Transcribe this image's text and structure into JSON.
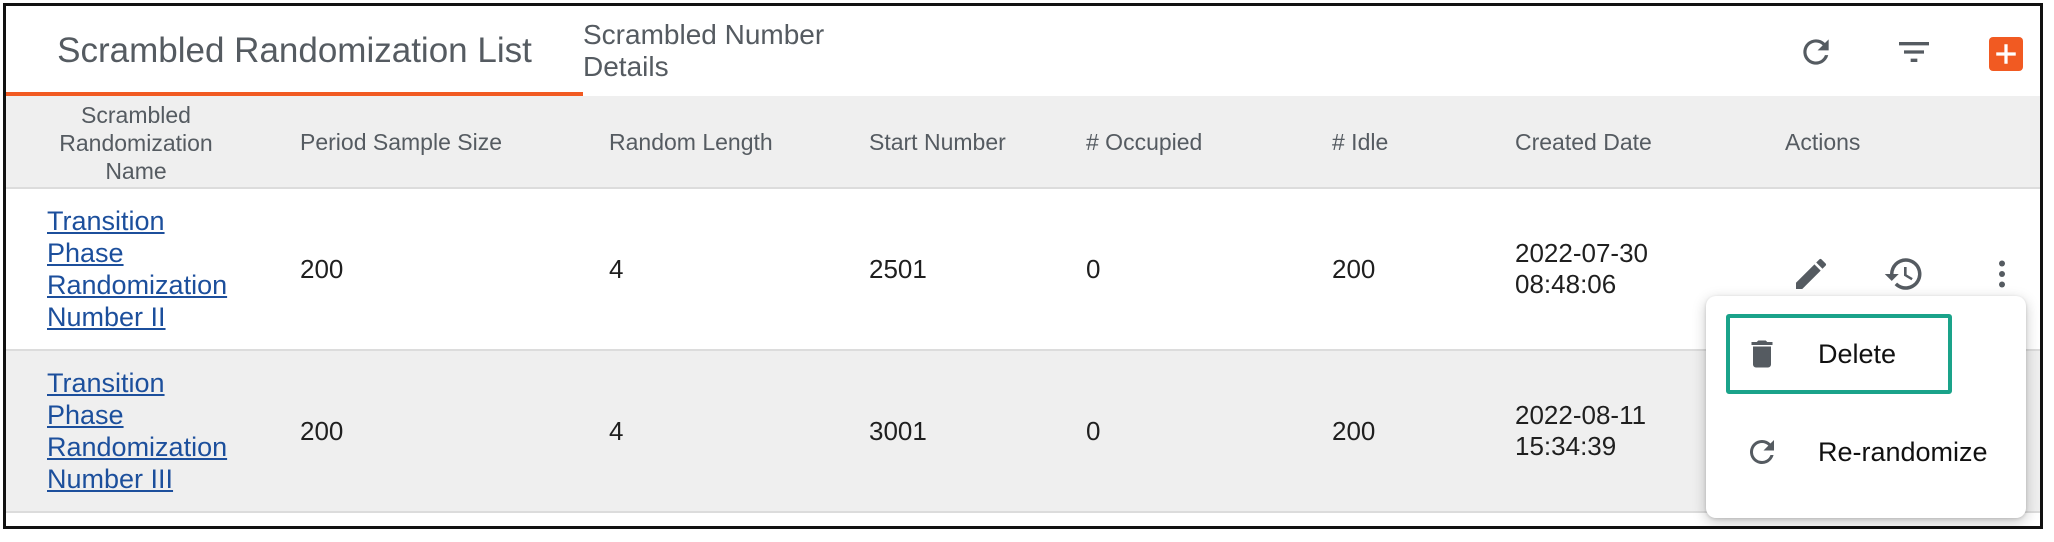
{
  "tabs": {
    "list": "Scrambled Randomization List",
    "details": "Scrambled Number Details"
  },
  "toolbar": {
    "refresh_icon": "refresh-icon",
    "filter_icon": "filter-icon",
    "add_icon": "add-icon"
  },
  "columns": {
    "name": "Scrambled Randomization Name",
    "period_sample_size": "Period Sample Size",
    "random_length": "Random Length",
    "start_number": "Start Number",
    "occupied": "# Occupied",
    "idle": "# Idle",
    "created_date": "Created Date",
    "actions": "Actions"
  },
  "rows": [
    {
      "name": "Transition Phase Randomization Number II",
      "period_sample_size": "200",
      "random_length": "4",
      "start_number": "2501",
      "occupied": "0",
      "idle": "200",
      "created_date": "2022-07-30 08:48:06"
    },
    {
      "name": "Transition Phase Randomization Number III",
      "period_sample_size": "200",
      "random_length": "4",
      "start_number": "3001",
      "occupied": "0",
      "idle": "200",
      "created_date": "2022-08-11 15:34:39"
    }
  ],
  "menu": {
    "delete": "Delete",
    "rerandomize": "Re-randomize"
  },
  "colors": {
    "accent": "#f15a22",
    "link": "#1c4f9c",
    "highlight": "#1aa38a",
    "header_bg": "#efefef"
  }
}
